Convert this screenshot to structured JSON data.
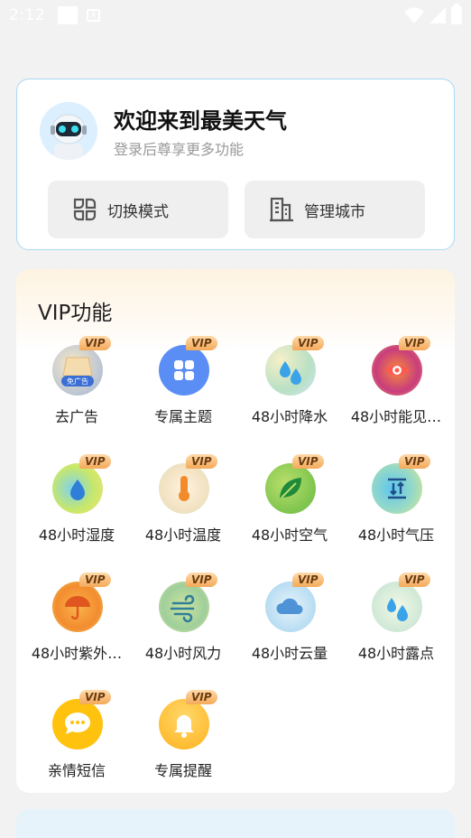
{
  "status_bar": {
    "time": "2:12"
  },
  "welcome": {
    "title": "欢迎来到最美天气",
    "subtitle": "登录后尊享更多功能",
    "buttons": [
      {
        "label": "切换模式",
        "icon": "grid-mode-icon"
      },
      {
        "label": "管理城市",
        "icon": "city-building-icon"
      }
    ]
  },
  "vip": {
    "title": "VIP功能",
    "badge": "VIP",
    "items": [
      {
        "label": "去广告",
        "icon": "no-ads-icon",
        "mini": "免广告"
      },
      {
        "label": "专属主题",
        "icon": "theme-icon"
      },
      {
        "label": "48小时降水",
        "icon": "precipitation-icon"
      },
      {
        "label": "48小时能见…",
        "icon": "visibility-icon"
      },
      {
        "label": "48小时湿度",
        "icon": "humidity-icon"
      },
      {
        "label": "48小时温度",
        "icon": "temperature-icon"
      },
      {
        "label": "48小时空气",
        "icon": "air-quality-icon"
      },
      {
        "label": "48小时气压",
        "icon": "pressure-icon"
      },
      {
        "label": "48小时紫外…",
        "icon": "uv-icon"
      },
      {
        "label": "48小时风力",
        "icon": "wind-icon"
      },
      {
        "label": "48小时云量",
        "icon": "cloud-icon"
      },
      {
        "label": "48小时露点",
        "icon": "dew-point-icon"
      },
      {
        "label": "亲情短信",
        "icon": "message-icon"
      },
      {
        "label": "专属提醒",
        "icon": "bell-icon"
      }
    ]
  }
}
